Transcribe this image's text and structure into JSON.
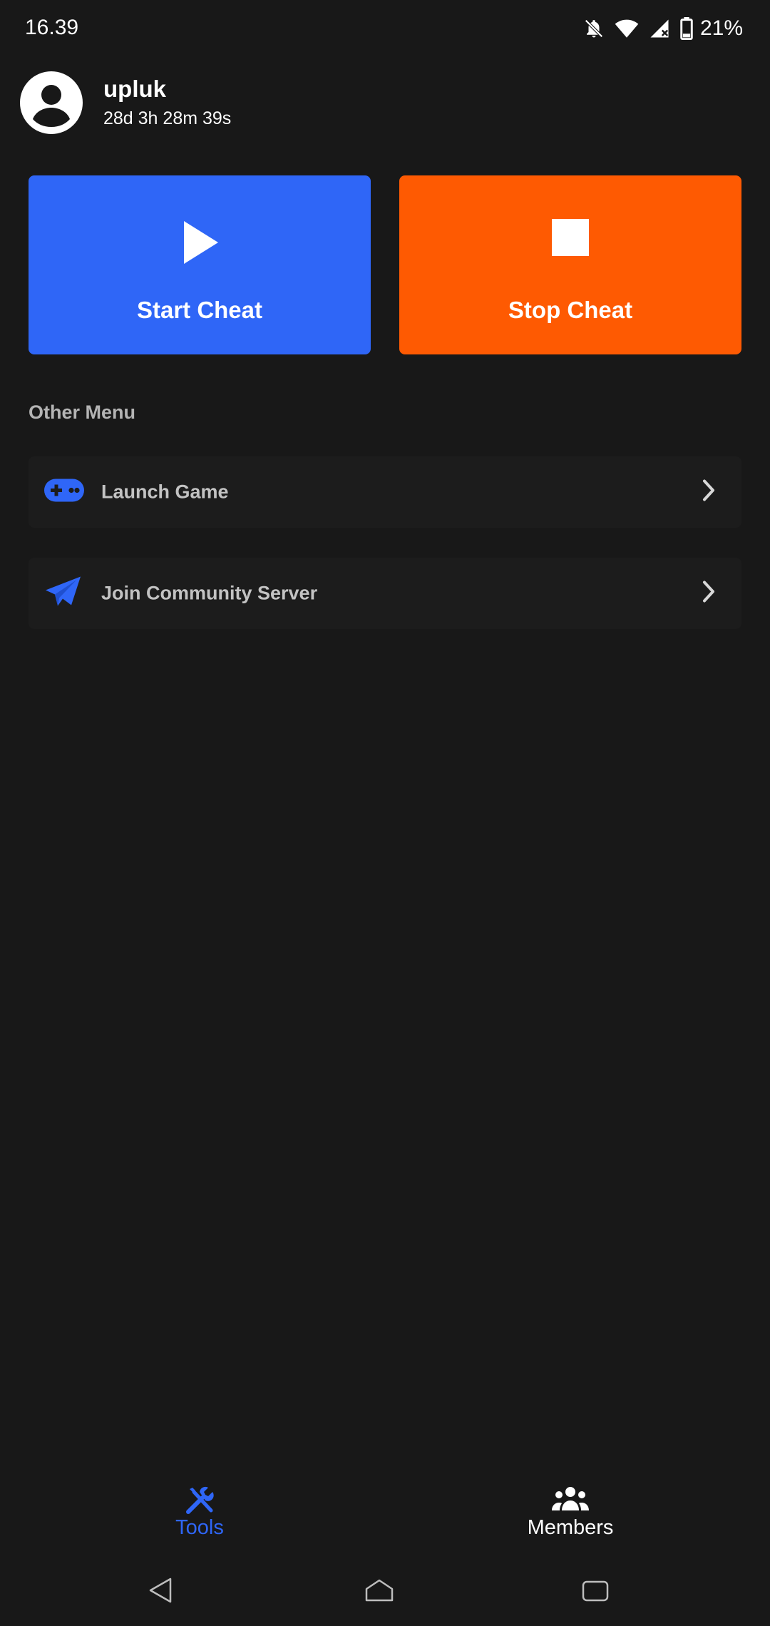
{
  "status_bar": {
    "time": "16.39",
    "battery": "21%",
    "icons": [
      "notifications-off-icon",
      "wifi-icon",
      "signal-icon",
      "battery-icon"
    ]
  },
  "profile": {
    "username": "upluk",
    "duration": "28d 3h 28m 39s",
    "avatar_icon": "account-circle-icon"
  },
  "actions": {
    "start": {
      "label": "Start Cheat",
      "icon": "play-icon",
      "color": "#2f66f7"
    },
    "stop": {
      "label": "Stop Cheat",
      "icon": "stop-icon",
      "color": "#fe5a02"
    }
  },
  "other_menu": {
    "title": "Other Menu",
    "items": [
      {
        "label": "Launch Game",
        "icon": "gamepad-icon"
      },
      {
        "label": "Join Community Server",
        "icon": "telegram-icon"
      }
    ]
  },
  "bottom_nav": {
    "items": [
      {
        "label": "Tools",
        "icon": "tools-icon",
        "active": true
      },
      {
        "label": "Members",
        "icon": "members-icon",
        "active": false
      }
    ]
  },
  "system_nav": {
    "icons": [
      "back-icon",
      "home-icon",
      "recents-icon"
    ]
  },
  "colors": {
    "background": "#181818",
    "accent": "#2f66f7",
    "danger": "#fe5a02",
    "muted_text": "#b4b4b4"
  }
}
